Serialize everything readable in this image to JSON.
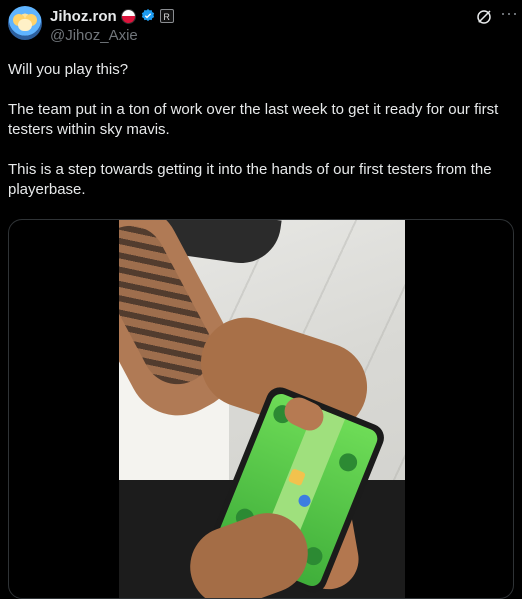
{
  "post": {
    "author": {
      "name": "Jihoz.ron",
      "handle": "@Jihoz_Axie",
      "affiliate_badge": "R",
      "avatar_icon": "avatar-axie",
      "flag_icon": "poland-flag-icon",
      "verified_icon": "verified-badge-icon",
      "verified_color": "#1d9bf0"
    },
    "actions": {
      "grok_icon": "grok-icon",
      "more_icon": "more-icon",
      "more_label": "⋯"
    },
    "text": {
      "p1": "Will you play this?",
      "p2": "The team put in a ton of work over the last week to get it ready for our first testers within sky mavis.",
      "p3": "This is a step towards getting it into the hands of our first testers from the playerbase."
    },
    "media": {
      "type": "video"
    }
  },
  "colors": {
    "background": "#000000",
    "text_primary": "#e7e9ea",
    "text_secondary": "#71767b",
    "border": "#2f3336"
  }
}
